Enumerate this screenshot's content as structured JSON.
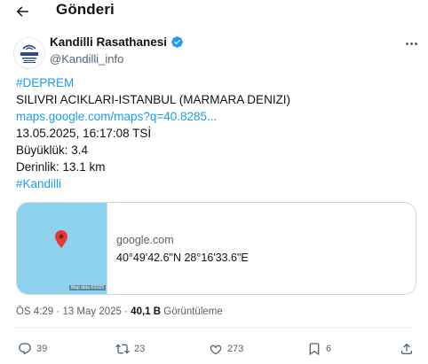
{
  "header": {
    "title": "Gönderi",
    "back_icon": "arrow-left-icon"
  },
  "author": {
    "name": "Kandilli Rasathanesi",
    "handle": "@Kandilli_info",
    "verified": true,
    "verified_color": "#1d9bf0",
    "avatar_text": "KANDİLLİ"
  },
  "post": {
    "hashtag1": "#DEPREM",
    "location": "SILIVRI ACIKLARI-ISTANBUL (MARMARA DENIZI)",
    "link": "maps.google.com/maps?q=40.8285...",
    "datetime": "13.05.2025, 16:17:08 TSİ",
    "magnitude": "Büyüklük: 3.4",
    "depth": "Derinlik: 13.1 km",
    "hashtag2": "#Kandilli"
  },
  "card": {
    "domain": "google.com",
    "coords": "40°49'42.6\"N 28°16'33.6\"E",
    "map_credit": "Map data ©2025",
    "map_color": "#8ed2ee",
    "pin_color": "#e53935"
  },
  "meta": {
    "time": "ÖS 4:29",
    "date": "13 May 2025",
    "views_count": "40,1 B",
    "views_label": "Görüntüleme"
  },
  "actions": {
    "replies": "39",
    "reposts": "23",
    "likes": "273",
    "bookmarks": "6"
  },
  "colors": {
    "link": "#1d9bf0",
    "text": "#0f1419",
    "muted": "#536471"
  }
}
